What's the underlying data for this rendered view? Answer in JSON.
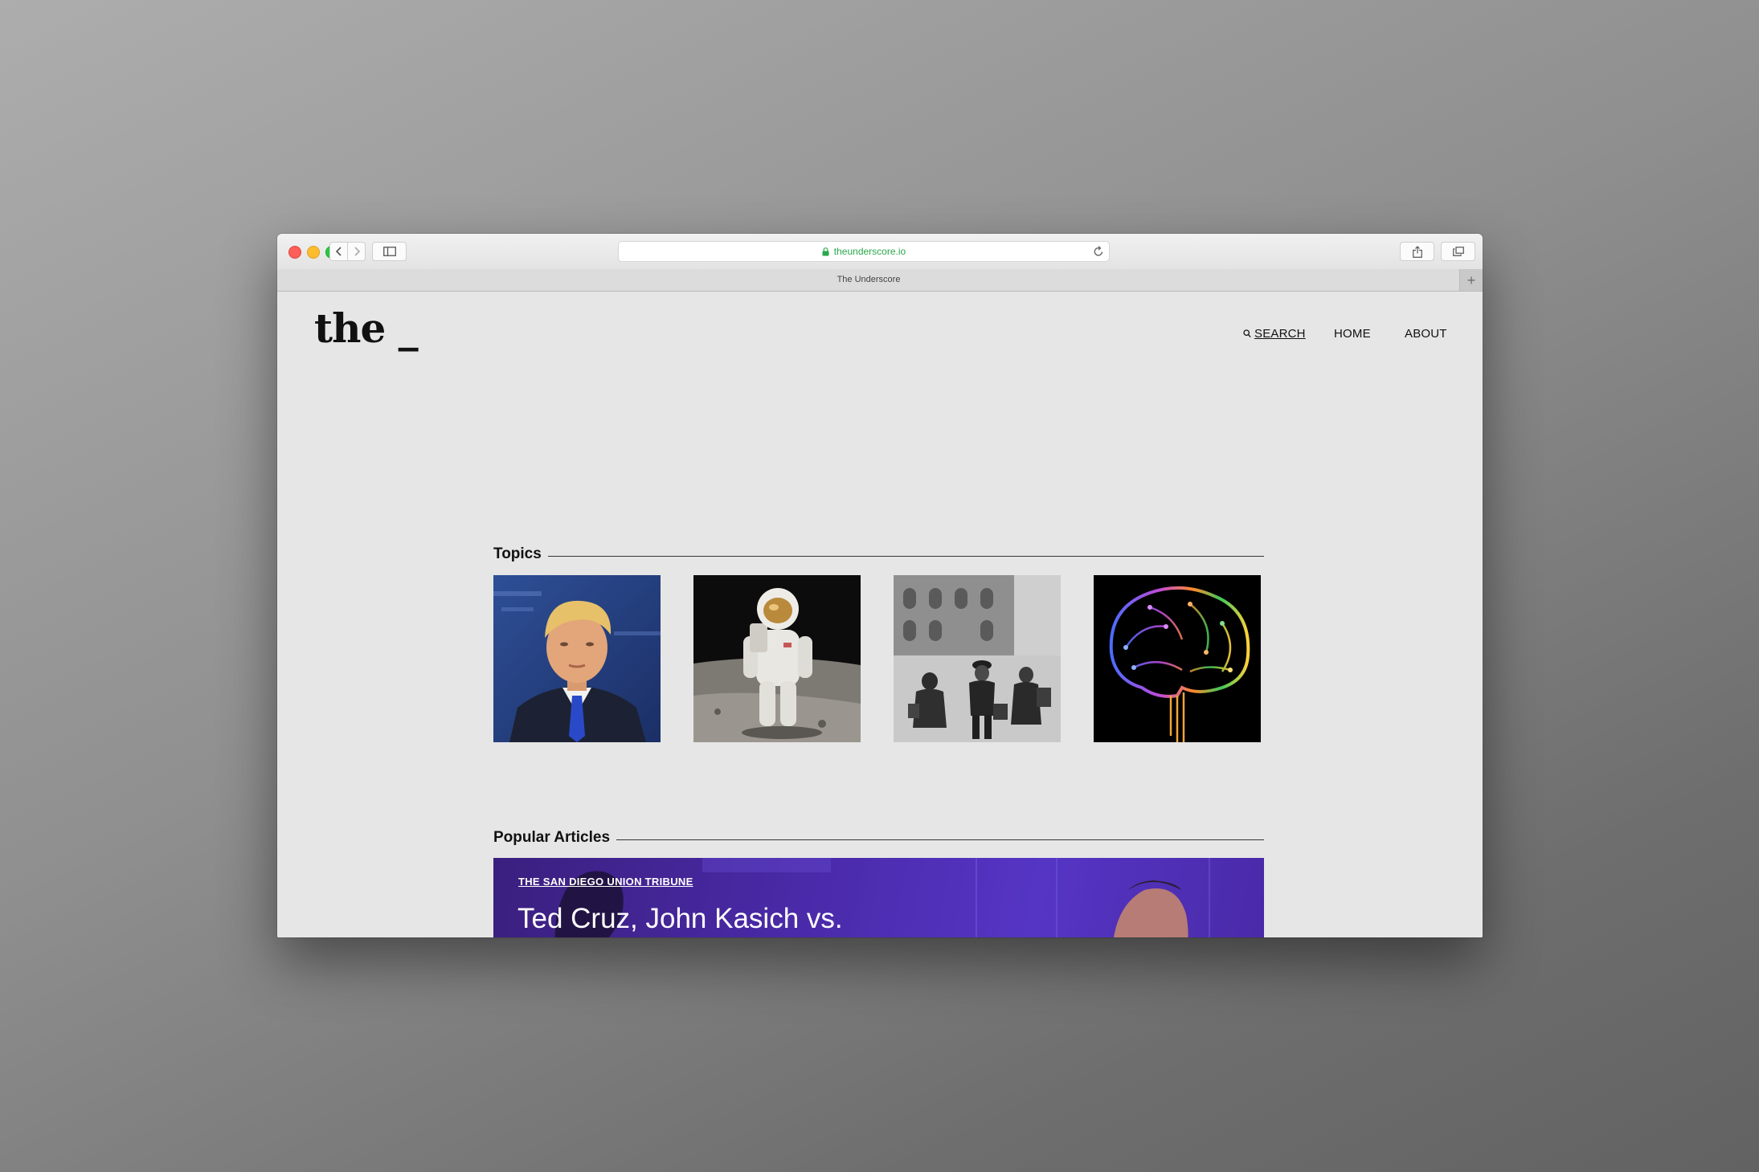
{
  "browser": {
    "url": "theunderscore.io",
    "tab_title": "The Underscore",
    "new_tab_symbol": "+"
  },
  "site": {
    "logo": "the _",
    "nav": {
      "search": "SEARCH",
      "home": "HOME",
      "about": "ABOUT"
    }
  },
  "topics": {
    "heading": "Topics",
    "items": [
      {
        "image": "portrait-photo"
      },
      {
        "image": "astronaut-photo"
      },
      {
        "image": "historic-street-photo"
      },
      {
        "image": "circuit-brain-illustration"
      }
    ]
  },
  "popular": {
    "heading": "Popular Articles",
    "featured": {
      "source": "THE SAN DIEGO UNION TRIBUNE",
      "headline": "Ted Cruz, John Kasich vs."
    }
  },
  "colors": {
    "url_green": "#2aa84a",
    "article_purple": "#4a2aa8",
    "page_bg": "#e6e6e6"
  },
  "icons": [
    "back-icon",
    "forward-icon",
    "sidebar-icon",
    "lock-icon",
    "reload-icon",
    "share-icon",
    "tabs-icon",
    "search-icon"
  ]
}
